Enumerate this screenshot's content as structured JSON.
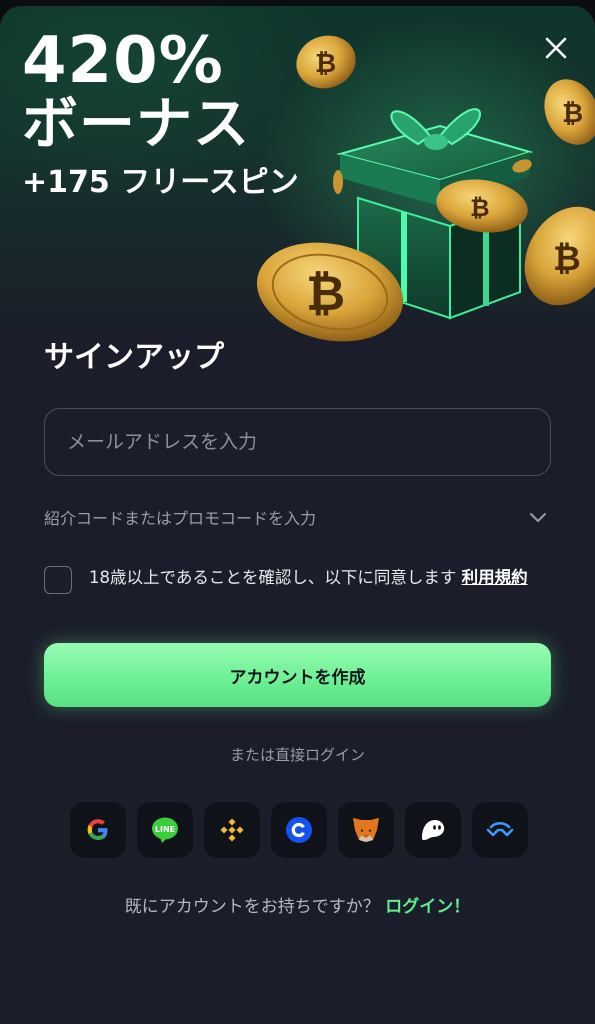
{
  "hero": {
    "line1": "420%",
    "line2": "ボーナス",
    "line3": "+175 フリースピン"
  },
  "signup": {
    "title": "サインアップ",
    "email_placeholder": "メールアドレスを入力",
    "email_value": "",
    "promo_label": "紹介コードまたはプロモコードを入力",
    "terms_text": "18歳以上であることを確認し、以下に同意します ",
    "terms_link": "利用規約",
    "terms_checked": false,
    "create_button": "アカウントを作成"
  },
  "social": {
    "or_text": "または直接ログイン",
    "providers": [
      "google-icon",
      "line-icon",
      "binance-icon",
      "coinbase-icon",
      "metamask-icon",
      "phantom-icon",
      "walletconnect-icon"
    ],
    "line_badge": "LINE"
  },
  "footer": {
    "question": "既にアカウントをお持ちですか？ ",
    "login_link": "ログイン！"
  },
  "colors": {
    "accent_green": "#6ff196",
    "login_link": "#5ff08d",
    "panel_bg": "#1b1e2a"
  }
}
